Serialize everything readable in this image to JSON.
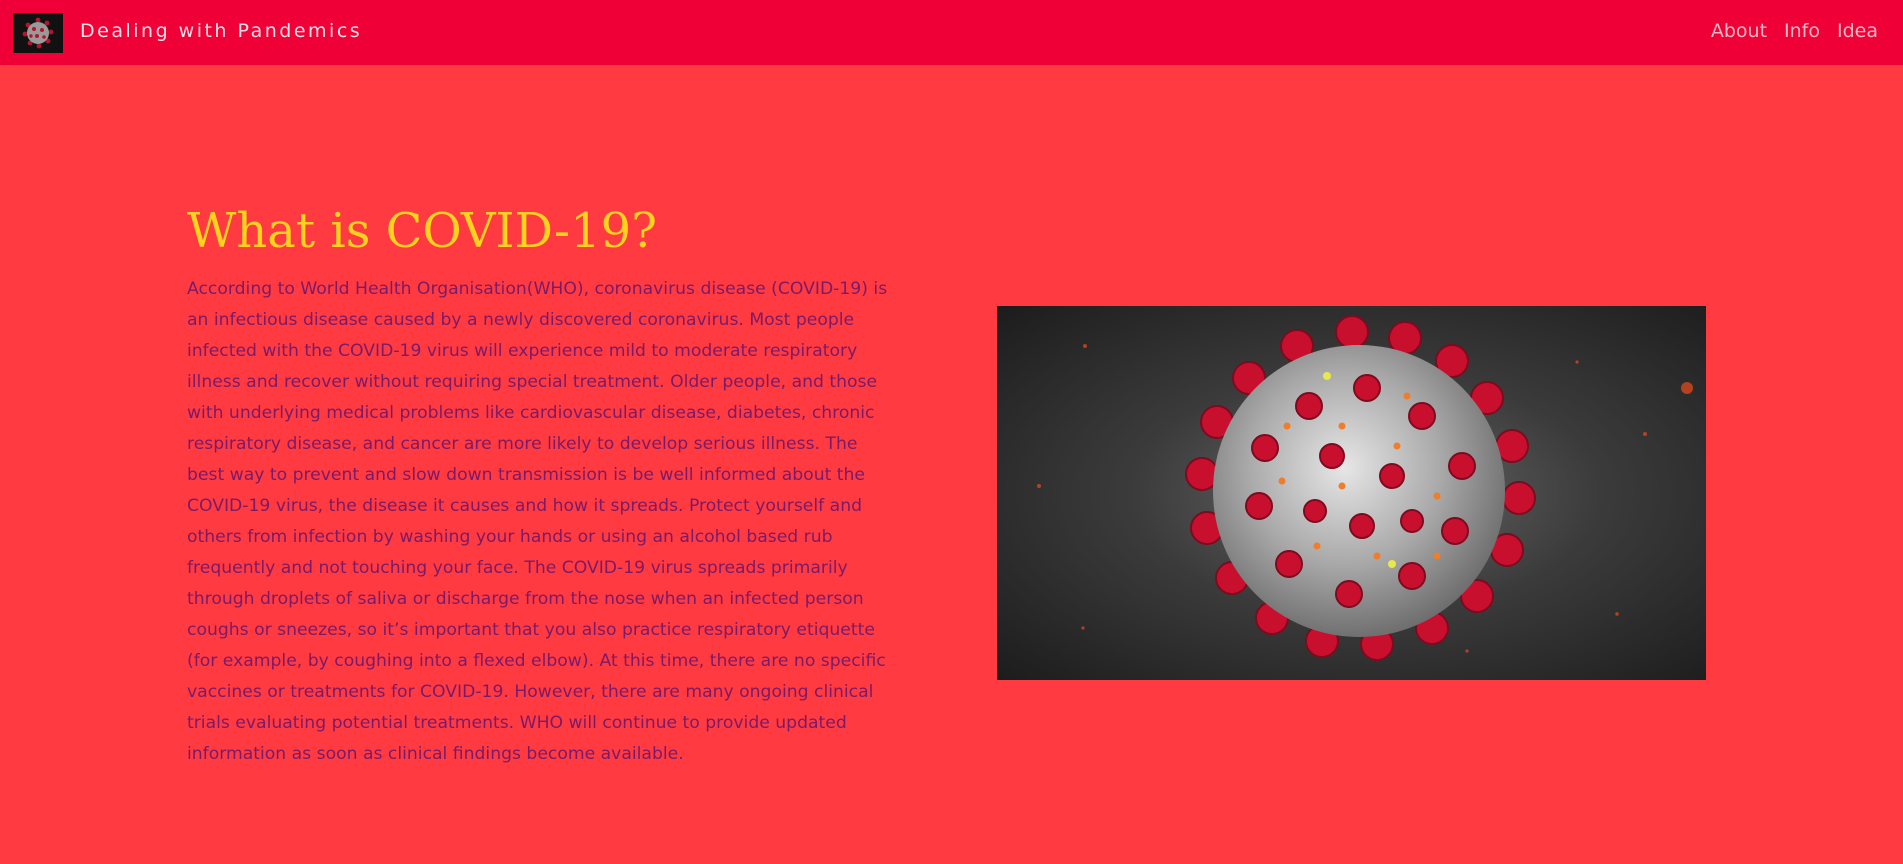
{
  "navbar": {
    "brand_title": "Dealing with Pandemics",
    "brand_icon": "virus-logo-icon",
    "links": [
      "About",
      "Info",
      "Idea"
    ]
  },
  "main": {
    "heading": "What is COVID-19?",
    "body": "According to World Health Organisation(WHO), coronavirus disease (COVID-19) is an infectious disease caused by a newly discovered coronavirus. Most people infected with the COVID-19 virus will experience mild to moderate respiratory illness and recover without requiring special treatment. Older people, and those with underlying medical problems like cardiovascular disease, diabetes, chronic respiratory disease, and cancer are more likely to develop serious illness. The best way to prevent and slow down transmission is be well informed about the COVID-19 virus, the disease it causes and how it spreads. Protect yourself and others from infection by washing your hands or using an alcohol based rub frequently and not touching your face. The COVID-19 virus spreads primarily through droplets of saliva or discharge from the nose when an infected person coughs or sneezes, so it’s important that you also practice respiratory etiquette (for example, by coughing into a flexed elbow). At this time, there are no specific vaccines or treatments for COVID-19. However, there are many ongoing clinical trials evaluating potential treatments. WHO will continue to provide updated information as soon as clinical findings become available.",
    "image_icon": "coronavirus-illustration"
  },
  "colors": {
    "page_background": "#ff3a40",
    "navbar_background": "#ef0037",
    "heading": "#ffd21f",
    "body_text": "#7b1a68",
    "nav_link": "#f7b8c3",
    "virus_spike": "#c8102e"
  }
}
